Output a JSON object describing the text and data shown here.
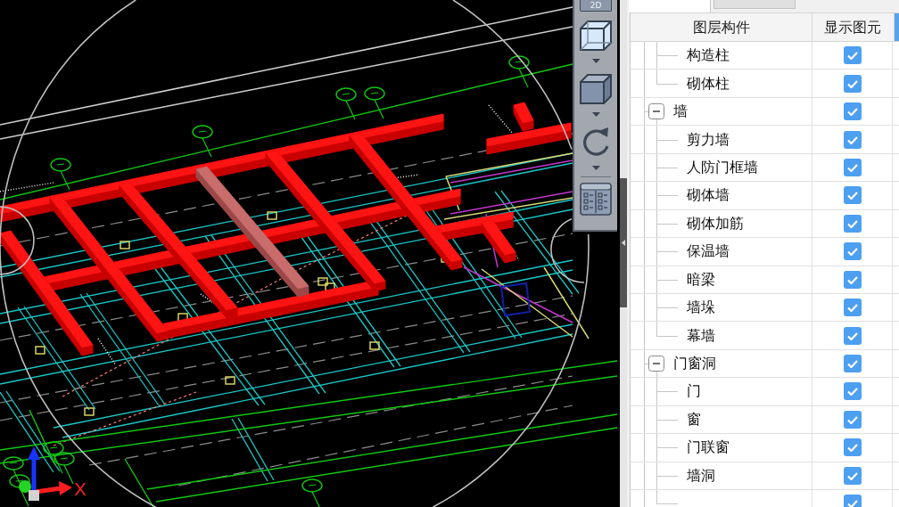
{
  "viewport": {
    "axis_label": "X"
  },
  "toolbar": {
    "mode_button": "2D"
  },
  "panel": {
    "tabs": [
      {
        "selected": true
      },
      {
        "selected": false
      }
    ],
    "columns": [
      "图层构件",
      "显示图元"
    ],
    "tree": [
      {
        "children": [
          {
            "label": "构造柱",
            "checked": true
          },
          {
            "label": "砌体柱",
            "checked": true
          }
        ]
      },
      {
        "label": "墙",
        "expanded": true,
        "checked": true,
        "children": [
          {
            "label": "剪力墙",
            "checked": true
          },
          {
            "label": "人防门框墙",
            "checked": true
          },
          {
            "label": "砌体墙",
            "checked": true
          },
          {
            "label": "砌体加筋",
            "checked": true
          },
          {
            "label": "保温墙",
            "checked": true
          },
          {
            "label": "暗梁",
            "checked": true
          },
          {
            "label": "墙垛",
            "checked": true
          },
          {
            "label": "幕墙",
            "checked": true
          }
        ]
      },
      {
        "label": "门窗洞",
        "expanded": true,
        "checked": true,
        "children": [
          {
            "label": "门",
            "checked": true
          },
          {
            "label": "窗",
            "checked": true
          },
          {
            "label": "门联窗",
            "checked": true
          },
          {
            "label": "墙洞",
            "checked": true
          },
          {
            "checked": true
          }
        ]
      }
    ]
  }
}
